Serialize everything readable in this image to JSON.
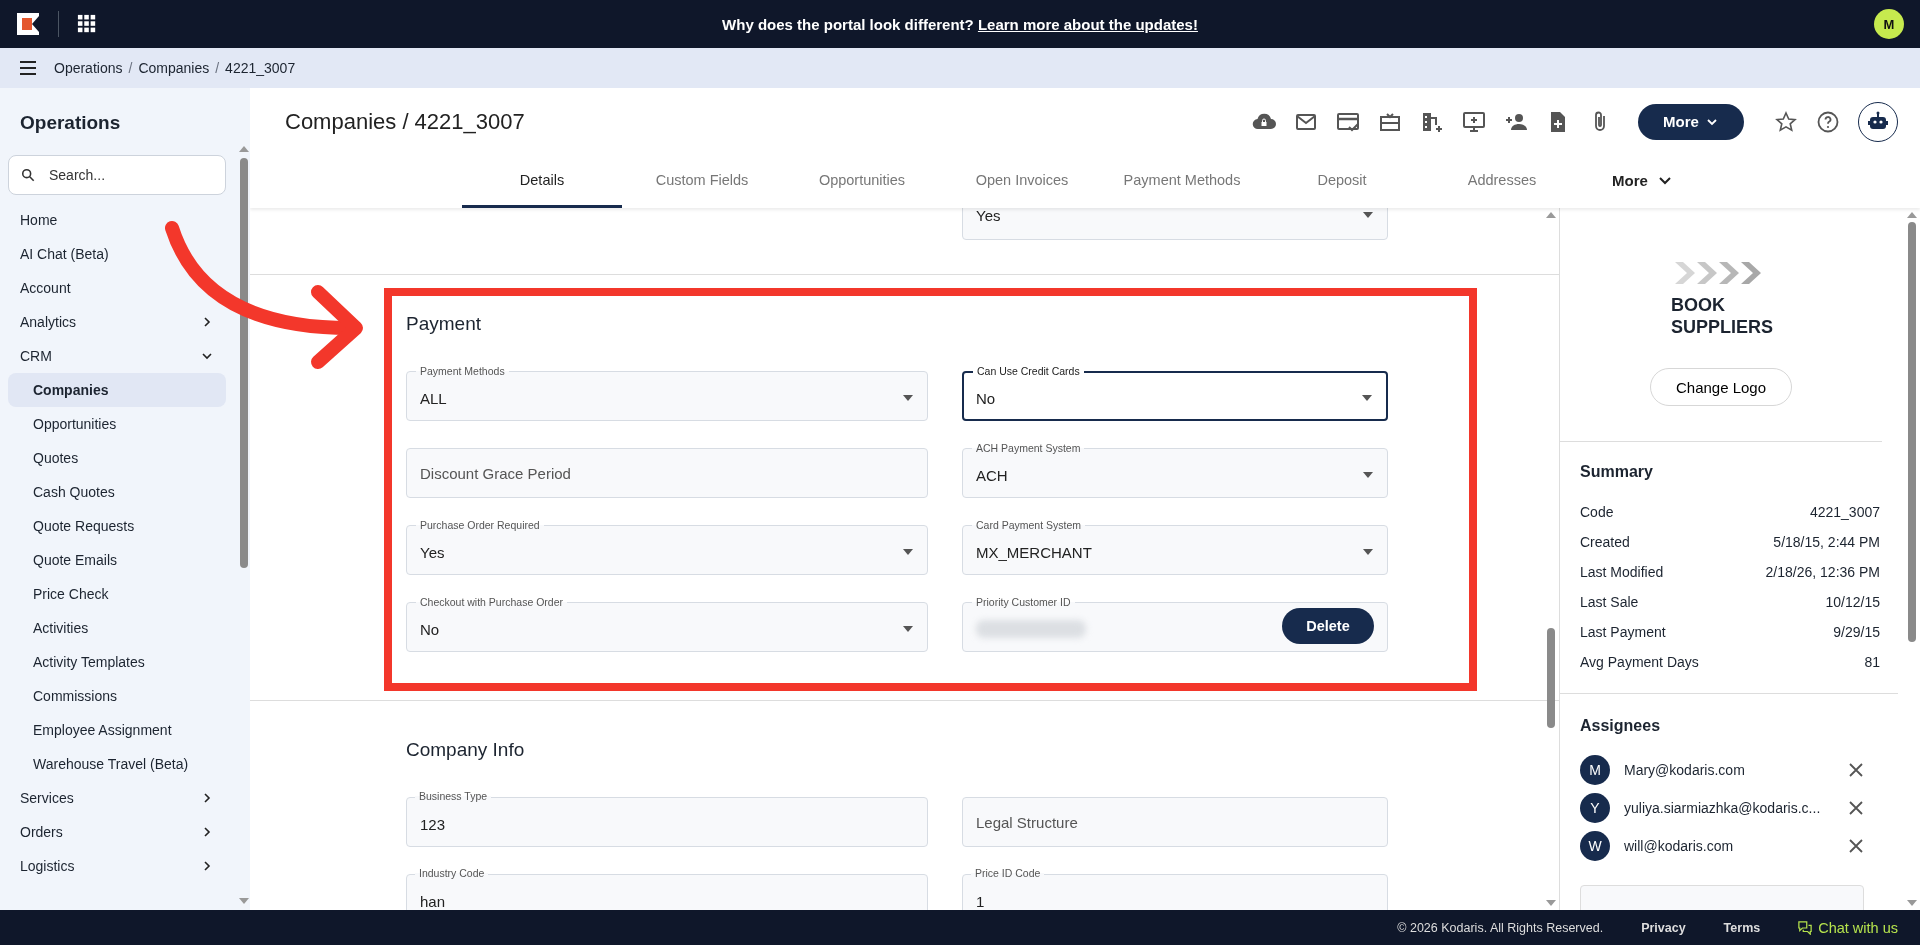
{
  "top_bar": {
    "announcement": "Why does the portal look different?",
    "link": "Learn more about the updates!",
    "avatar": "M"
  },
  "breadcrumb": {
    "separator": "/",
    "items": [
      "Operations",
      "Companies",
      "4221_3007"
    ]
  },
  "sidebar": {
    "title": "Operations",
    "search": {
      "placeholder": "Search..."
    },
    "items": [
      {
        "label": "Home",
        "selected": false
      },
      {
        "label": "AI Chat (Beta)",
        "selected": false
      },
      {
        "label": "Account",
        "selected": false
      },
      {
        "label": "Analytics",
        "selected": false,
        "expanded": false
      },
      {
        "label": "CRM",
        "selected": false,
        "expanded": true,
        "children": [
          {
            "label": "Companies",
            "selected": true
          },
          {
            "label": "Opportunities",
            "selected": false
          },
          {
            "label": "Quotes",
            "selected": false
          },
          {
            "label": "Cash Quotes",
            "selected": false
          },
          {
            "label": "Quote Requests",
            "selected": false
          },
          {
            "label": "Quote Emails",
            "selected": false
          },
          {
            "label": "Price Check",
            "selected": false
          },
          {
            "label": "Activities",
            "selected": false
          },
          {
            "label": "Activity Templates",
            "selected": false
          },
          {
            "label": "Commissions",
            "selected": false
          },
          {
            "label": "Employee Assignment",
            "selected": false
          },
          {
            "label": "Warehouse Travel (Beta)",
            "selected": false
          }
        ]
      },
      {
        "label": "Services",
        "selected": false,
        "expanded": false
      },
      {
        "label": "Orders",
        "selected": false,
        "expanded": false
      },
      {
        "label": "Logistics",
        "selected": false,
        "expanded": false
      }
    ]
  },
  "page": {
    "title": "Companies / 4221_3007",
    "more_button": "More"
  },
  "tabs": [
    {
      "label": "Details",
      "selected": true
    },
    {
      "label": "Custom Fields",
      "selected": false
    },
    {
      "label": "Opportunities",
      "selected": false
    },
    {
      "label": "Open Invoices",
      "selected": false
    },
    {
      "label": "Payment Methods",
      "selected": false
    },
    {
      "label": "Deposit",
      "selected": false
    },
    {
      "label": "Addresses",
      "selected": false
    },
    {
      "label": "More",
      "selected": false,
      "kind": "menu"
    }
  ],
  "clipped_field": {
    "value": "Yes",
    "kind": "select"
  },
  "sections": [
    {
      "title": "Payment",
      "highlighted": true,
      "rows": [
        {
          "fields": [
            {
              "label": "Payment Methods",
              "value": "ALL",
              "kind": "select",
              "focused": false
            },
            {
              "label": "Can Use Credit Cards",
              "value": "No",
              "kind": "select",
              "focused": true
            }
          ]
        },
        {
          "fields": [
            {
              "placeholder": "Discount Grace Period",
              "kind": "text",
              "focused": false
            },
            {
              "label": "ACH Payment System",
              "value": "ACH",
              "kind": "select",
              "focused": false
            }
          ]
        },
        {
          "fields": [
            {
              "label": "Purchase Order Required",
              "value": "Yes",
              "kind": "select",
              "focused": false
            },
            {
              "label": "Card Payment System",
              "value": "MX_MERCHANT",
              "kind": "select",
              "focused": false
            }
          ]
        },
        {
          "fields": [
            {
              "label": "Checkout with Purchase Order",
              "value": "No",
              "kind": "select",
              "focused": false
            },
            {
              "label": "Priority Customer ID",
              "kind": "redacted",
              "button": "Delete",
              "focused": false
            }
          ]
        }
      ]
    },
    {
      "title": "Company Info",
      "highlighted": false,
      "rows": [
        {
          "fields": [
            {
              "label": "Business Type",
              "value": "123",
              "kind": "text",
              "focused": false
            },
            {
              "placeholder": "Legal Structure",
              "kind": "text",
              "focused": false
            }
          ]
        },
        {
          "fields": [
            {
              "label": "Industry Code",
              "value": "han",
              "kind": "text",
              "focused": false
            },
            {
              "label": "Price ID Code",
              "value": "1",
              "kind": "text",
              "focused": false
            }
          ]
        }
      ]
    }
  ],
  "right_panel": {
    "logo_lines": [
      "BOOK",
      "SUPPLIERS"
    ],
    "change_logo": "Change Logo",
    "summary": {
      "title": "Summary",
      "rows": [
        {
          "label": "Code",
          "value": "4221_3007"
        },
        {
          "label": "Created",
          "value": "5/18/15, 2:44 PM"
        },
        {
          "label": "Last Modified",
          "value": "2/18/26, 12:36 PM"
        },
        {
          "label": "Last Sale",
          "value": "10/12/15"
        },
        {
          "label": "Last Payment",
          "value": "9/29/15"
        },
        {
          "label": "Avg Payment Days",
          "value": "81"
        }
      ]
    },
    "assignees": {
      "title": "Assignees",
      "items": [
        {
          "initial": "M",
          "email": "Mary@kodaris.com"
        },
        {
          "initial": "Y",
          "email": "yuliya.siarmiazhka@kodaris.c..."
        },
        {
          "initial": "W",
          "email": "will@kodaris.com"
        }
      ]
    }
  },
  "footer": {
    "copyright": "© 2026 Kodaris. All Rights Reserved.",
    "links": [
      "Privacy",
      "Terms"
    ],
    "chat": "Chat with us"
  }
}
